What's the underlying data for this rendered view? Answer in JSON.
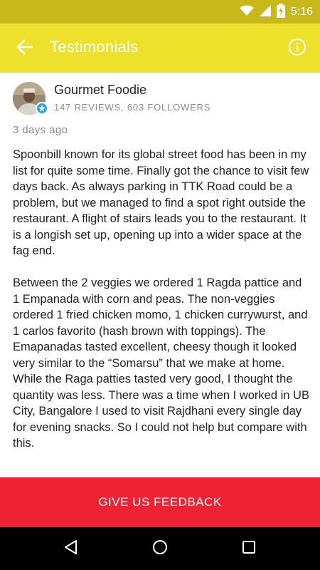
{
  "status_bar": {
    "time": "5:16",
    "icons": [
      "wifi-icon",
      "signal-icon",
      "battery-charging-icon"
    ]
  },
  "app_bar": {
    "title": "Testimonials",
    "back_icon": "arrow-left-icon",
    "info_icon": "info-icon"
  },
  "review": {
    "reviewer_name": "Gourmet Foodie",
    "reviewer_stats": "147 REVIEWS, 603 FOLLOWERS",
    "time_ago": "3 days ago",
    "paragraphs": [
      "Spoonbill known for its global street food has been in my list for quite some time. Finally got the chance to visit few days back. As always parking in TTK Road could be a problem, but we managed to find a spot right outside the restaurant. A flight of stairs leads you to the restaurant. It is a longish set up, opening up into a wider space at the fag end.",
      "Between the 2 veggies we ordered 1 Ragda pattice and 1 Empanada with corn and peas. The non-veggies ordered 1 fried chicken momo, 1 chicken currywurst, and 1 carlos favorito (hash brown with toppings). The Emapanadas tasted excellent, cheesy though it looked very similar to the “Somarsu” that we make at home. While the Raga patties tasted very good, I thought the quantity was less. There was a time when I worked in UB City, Bangalore I used to visit Rajdhani every single day for evening snacks. So I could not help but compare with this."
    ]
  },
  "footer": {
    "feedback_label": "GIVE US FEEDBACK"
  },
  "colors": {
    "status_bar": "#c8b81a",
    "app_bar": "#ede12c",
    "feedback": "#ee2233",
    "verified_badge": "#2aa3e0"
  }
}
